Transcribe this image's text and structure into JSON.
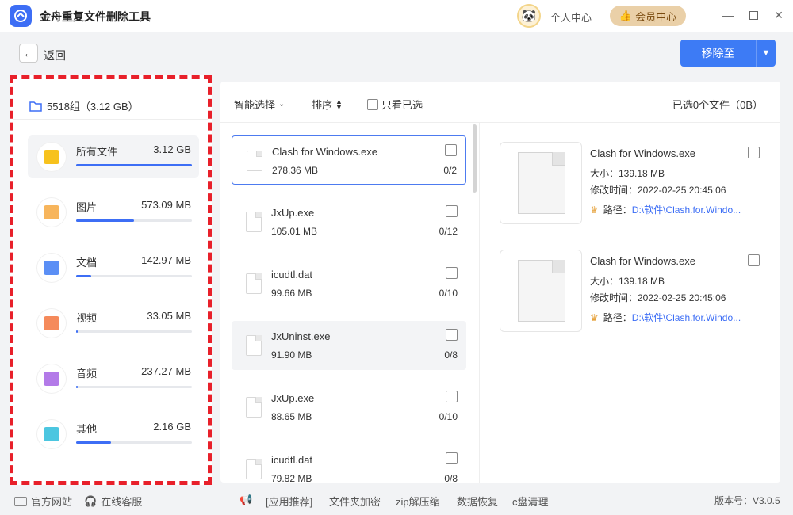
{
  "app": {
    "title": "金舟重复文件删除工具"
  },
  "header": {
    "profile_label": "个人中心",
    "vip_label": "会员中心"
  },
  "nav": {
    "back_label": "返回",
    "move_label": "移除至"
  },
  "groups": {
    "header": "5518组（3.12 GB）"
  },
  "categories": [
    {
      "name": "所有文件",
      "size": "3.12 GB",
      "fraction": 1.0,
      "color": "#f7c21d",
      "icon": "folder-icon"
    },
    {
      "name": "图片",
      "size": "573.09 MB",
      "fraction": 0.5,
      "color": "#f7b55c",
      "icon": "image-icon"
    },
    {
      "name": "文档",
      "size": "142.97 MB",
      "fraction": 0.13,
      "color": "#5b8ff5",
      "icon": "document-icon"
    },
    {
      "name": "视频",
      "size": "33.05 MB",
      "fraction": 0.0,
      "color": "#f58a5b",
      "icon": "video-icon"
    },
    {
      "name": "音频",
      "size": "237.27 MB",
      "fraction": 0.01,
      "color": "#b37ae8",
      "icon": "music-icon"
    },
    {
      "name": "其他",
      "size": "2.16 GB",
      "fraction": 0.3,
      "color": "#4cc6e0",
      "icon": "apps-icon"
    }
  ],
  "toolbar": {
    "smart_select": "智能选择",
    "sort": "排序",
    "only_selected": "只看已选",
    "selected_info": "已选0个文件（0B）"
  },
  "files": [
    {
      "name": "Clash for Windows.exe",
      "size": "278.36 MB",
      "count": "0/2"
    },
    {
      "name": "JxUp.exe",
      "size": "105.01 MB",
      "count": "0/12"
    },
    {
      "name": "icudtl.dat",
      "size": "99.66 MB",
      "count": "0/10"
    },
    {
      "name": "JxUninst.exe",
      "size": "91.90 MB",
      "count": "0/8"
    },
    {
      "name": "JxUp.exe",
      "size": "88.65 MB",
      "count": "0/10"
    },
    {
      "name": "icudtl.dat",
      "size": "79.82 MB",
      "count": "0/8"
    }
  ],
  "details": [
    {
      "name": "Clash for Windows.exe",
      "size": "大小：139.18 MB",
      "modified": "修改时间：2022-02-25 20:45:06",
      "path_label": "路径：",
      "path": "D:\\软件\\Clash.for.Windo..."
    },
    {
      "name": "Clash for Windows.exe",
      "size": "大小：139.18 MB",
      "modified": "修改时间：2022-02-25 20:45:06",
      "path_label": "路径：",
      "path": "D:\\软件\\Clash.for.Windo..."
    }
  ],
  "footer": {
    "official_site": "官方网站",
    "online_service": "在线客服",
    "links": [
      "[应用推荐]",
      "文件夹加密",
      "zip解压缩",
      "数据恢复",
      "c盘清理"
    ],
    "version": "版本号：V3.0.5"
  }
}
